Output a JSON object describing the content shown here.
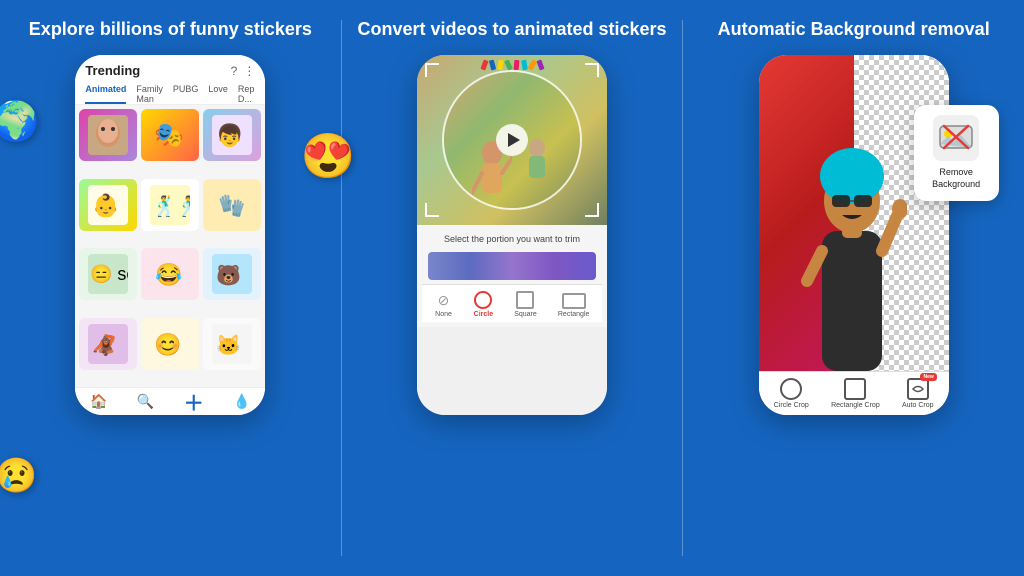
{
  "panels": [
    {
      "id": "stickers",
      "title": "Explore billions\nof funny stickers",
      "phone": {
        "header_title": "Trending",
        "tabs": [
          "Animated",
          "Family Man",
          "PUBG",
          "Love",
          "Republic D..."
        ],
        "active_tab": "Animated"
      },
      "bottom_icons": [
        "🏠",
        "🔍",
        "➕",
        "💧"
      ]
    },
    {
      "id": "video",
      "title": "Convert videos to\nanimated stickers",
      "select_text": "Select the portion you want to trim",
      "tools": [
        {
          "label": "None",
          "active": false
        },
        {
          "label": "Circle",
          "active": true
        },
        {
          "label": "Square",
          "active": false
        },
        {
          "label": "Rectangle",
          "active": false
        }
      ]
    },
    {
      "id": "background",
      "title": "Automatic\nBackground removal",
      "remove_bg_card": {
        "label": "Remove\nBackground",
        "icon": "🌅"
      },
      "tools": [
        {
          "label": "Circle Crop",
          "active": false
        },
        {
          "label": "Rectangle Crop",
          "active": false
        },
        {
          "label": "Auto Crop",
          "active": false,
          "badge": "New"
        }
      ]
    }
  ],
  "colors": {
    "background": "#1565C0",
    "white": "#ffffff",
    "accent_red": "#e53935"
  }
}
